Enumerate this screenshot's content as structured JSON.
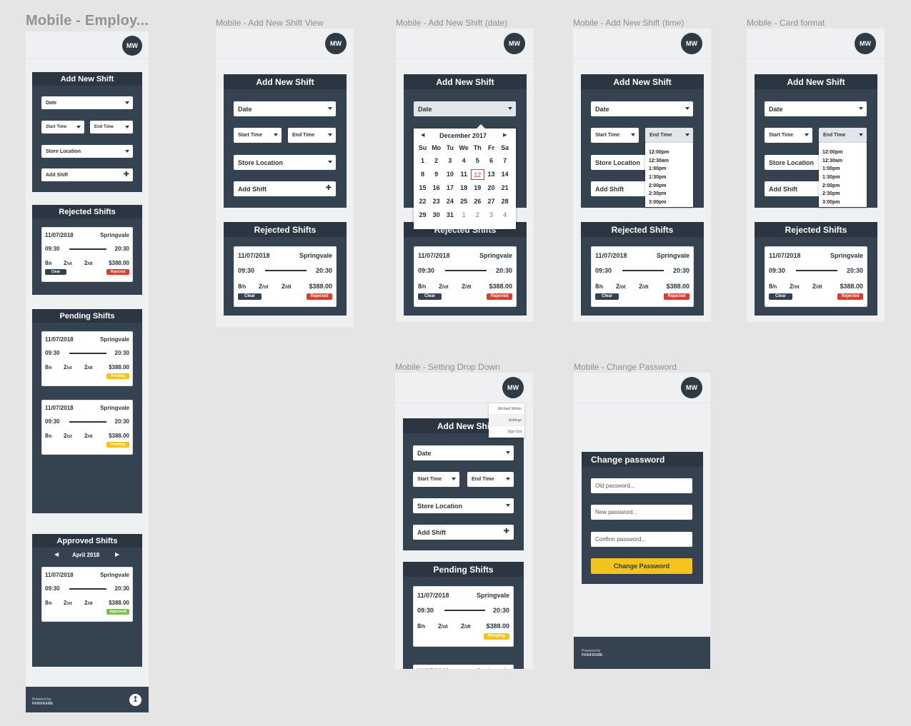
{
  "frames": {
    "employee": "Mobile - Employ...",
    "add_view": "Mobile - Add New Shift View",
    "add_date": "Mobile - Add New Shift (date)",
    "add_time": "Mobile - Add New Shift (time)",
    "card": "Mobile - Card format",
    "setting": "Mobile - Setting Drop Down",
    "password": "Mobile - Change Password"
  },
  "avatar": "MW",
  "add_shift": {
    "title": "Add New Shift",
    "title_cut": "Add New Shi",
    "date": "Date",
    "start": "Start Time",
    "end": "End Time",
    "store": "Store Location",
    "add": "Add Shift",
    "plus": "✚"
  },
  "panels": {
    "rejected": "Rejected Shifts",
    "rejected_cut": "Rejected Shifts",
    "pending": "Pending Shifts",
    "approved": "Approved Shifts"
  },
  "approved_nav": {
    "month": "April 2018",
    "prev": "◀",
    "next": "▶"
  },
  "shift": {
    "date": "11/07/2018",
    "location": "Springvale",
    "start": "09:30",
    "end": "20:30",
    "hours_num": "8",
    "hours_unit": "/h",
    "ot_num": "2",
    "ot_unit": "/ot",
    "dt_num": "2",
    "dt_unit": "/dt",
    "amount": "$388.00",
    "clear": "Clear",
    "rejected": "Rejected",
    "pending": "Pending",
    "approved": "Approved"
  },
  "calendar": {
    "prev": "◀",
    "next": "▶",
    "month": "December 2017",
    "weekdays": [
      "Su",
      "Mo",
      "Tu",
      "We",
      "Th",
      "Fr",
      "Sa"
    ],
    "weeks": [
      [
        "1",
        "2",
        "3",
        "4",
        "5",
        "6",
        "7"
      ],
      [
        "8",
        "9",
        "10",
        "11",
        "12",
        "13",
        "14"
      ],
      [
        "15",
        "16",
        "17",
        "18",
        "19",
        "20",
        "21"
      ],
      [
        "22",
        "23",
        "24",
        "25",
        "26",
        "27",
        "28"
      ],
      [
        "29",
        "30",
        "31",
        "1",
        "2",
        "3",
        "4"
      ]
    ],
    "selected": "12"
  },
  "time_options": [
    "12:00pm",
    "12:30am",
    "1:00pm",
    "1:30pm",
    "2:00pm",
    "2:30pm",
    "3:00pm"
  ],
  "settings_menu": [
    "Michael Winter",
    "Settings",
    "Sign Out"
  ],
  "password": {
    "title": "Change password",
    "old": "Old password...",
    "new": "New password...",
    "confirm": "Confirm password...",
    "button": "Change Password"
  },
  "footer": {
    "line1": "Powered by",
    "line2": "PAINFRAME"
  },
  "colors": {
    "dark": "#354250",
    "header": "#2b3642",
    "rejected": "#e03a2c",
    "pending": "#f6c21c",
    "approved": "#7cc142",
    "button": "#f6c21c"
  }
}
